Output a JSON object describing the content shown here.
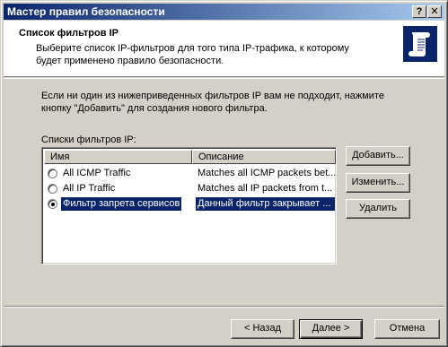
{
  "window": {
    "title": "Мастер правил безопасности",
    "help_glyph": "?",
    "close_glyph": "✕"
  },
  "header": {
    "title": "Список фильтров IP",
    "description": "Выберите список IP-фильтров для того типа IP-трафика, к которому будет применено правило безопасности.",
    "icon": "scroll-document-icon"
  },
  "intro": "Если ни один из нижеприведенных фильтров IP вам не подходит, нажмите кнопку \"Добавить\" для создания нового фильтра.",
  "list": {
    "label": "Списки фильтров IP:",
    "columns": {
      "name": "Имя",
      "description": "Описание"
    },
    "rows": [
      {
        "name": "All ICMP Traffic",
        "description": "Matches all ICMP packets bet...",
        "checked": false,
        "selected": false
      },
      {
        "name": "All IP Traffic",
        "description": "Matches all IP packets from t...",
        "checked": false,
        "selected": false
      },
      {
        "name": "Фильтр запрета сервисов",
        "description": "Данный фильтр закрывает ...",
        "checked": true,
        "selected": true
      }
    ]
  },
  "buttons": {
    "add": "Добавить...",
    "edit": "Изменить...",
    "delete": "Удалить",
    "back": "< Назад",
    "next": "Далее >",
    "cancel": "Отмена"
  }
}
